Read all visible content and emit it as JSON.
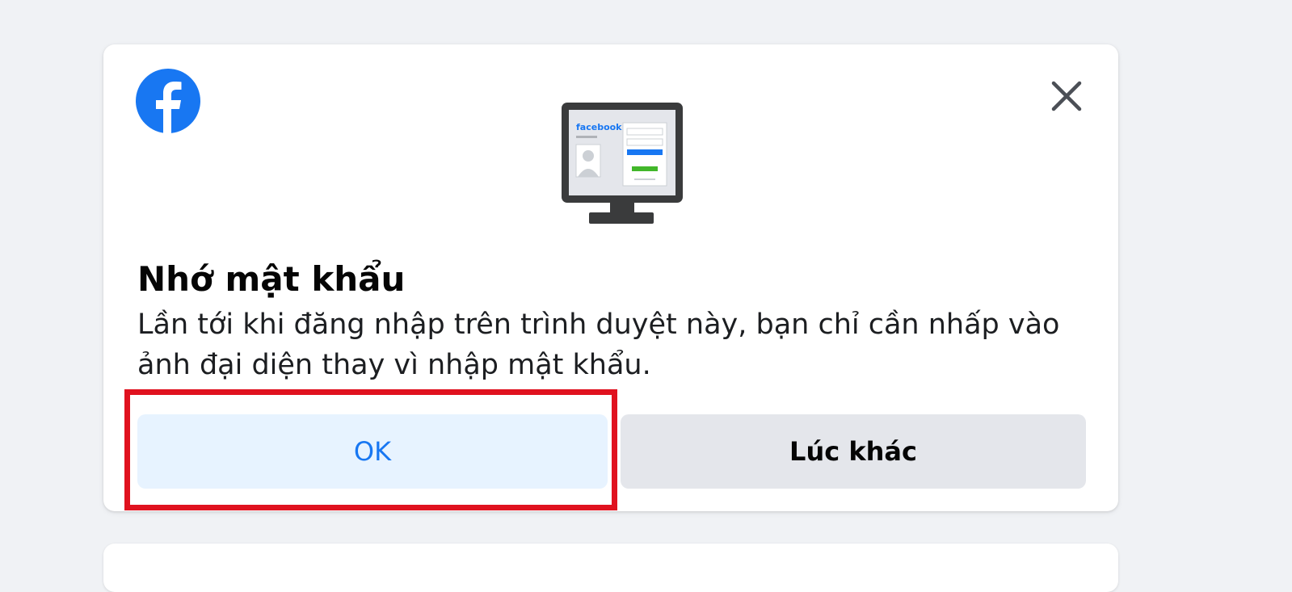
{
  "dialog": {
    "title": "Nhớ mật khẩu",
    "description": "Lần tới khi đăng nhập trên trình duyệt này, bạn chỉ cần nhấp vào ảnh đại diện thay vì nhập mật khẩu.",
    "ok_label": "OK",
    "later_label": "Lúc khác",
    "illustration_brand_text": "facebook"
  },
  "icons": {
    "logo": "facebook-logo-icon",
    "close": "close-icon",
    "illustration": "computer-monitor-illustration"
  },
  "colors": {
    "brand_blue": "#1877f2",
    "ok_button_bg": "#e7f3ff",
    "secondary_button_bg": "#e4e6eb",
    "highlight_red": "#e0121f",
    "page_bg": "#f0f2f5",
    "accent_green": "#42b72a"
  }
}
